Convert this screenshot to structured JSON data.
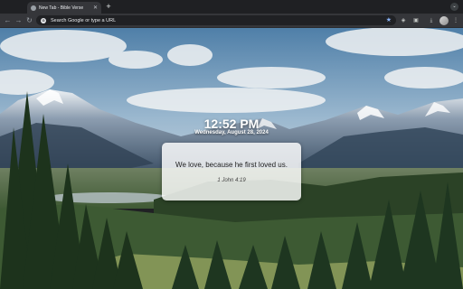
{
  "browser": {
    "tab_title": "New Tab - Bible Verse",
    "new_tab_symbol": "+",
    "omnibox_placeholder": "Search Google or type a URL"
  },
  "page": {
    "time": "12:52 PM",
    "date": "Wednesday, August 28, 2024",
    "verse_text": "We love, because he first loved us.",
    "verse_reference": "1 John 4:19"
  },
  "icons": {
    "back": "back-arrow-icon",
    "forward": "forward-arrow-icon",
    "reload": "reload-icon",
    "star": "bookmark-star-icon",
    "extension": "extension-icon",
    "download": "download-icon",
    "menu": "kebab-menu-icon"
  },
  "colors": {
    "chrome_dark": "#1f2023",
    "toolbar": "#35363a",
    "accent_star": "#8ab4f8",
    "card_bg": "#ffffff"
  }
}
